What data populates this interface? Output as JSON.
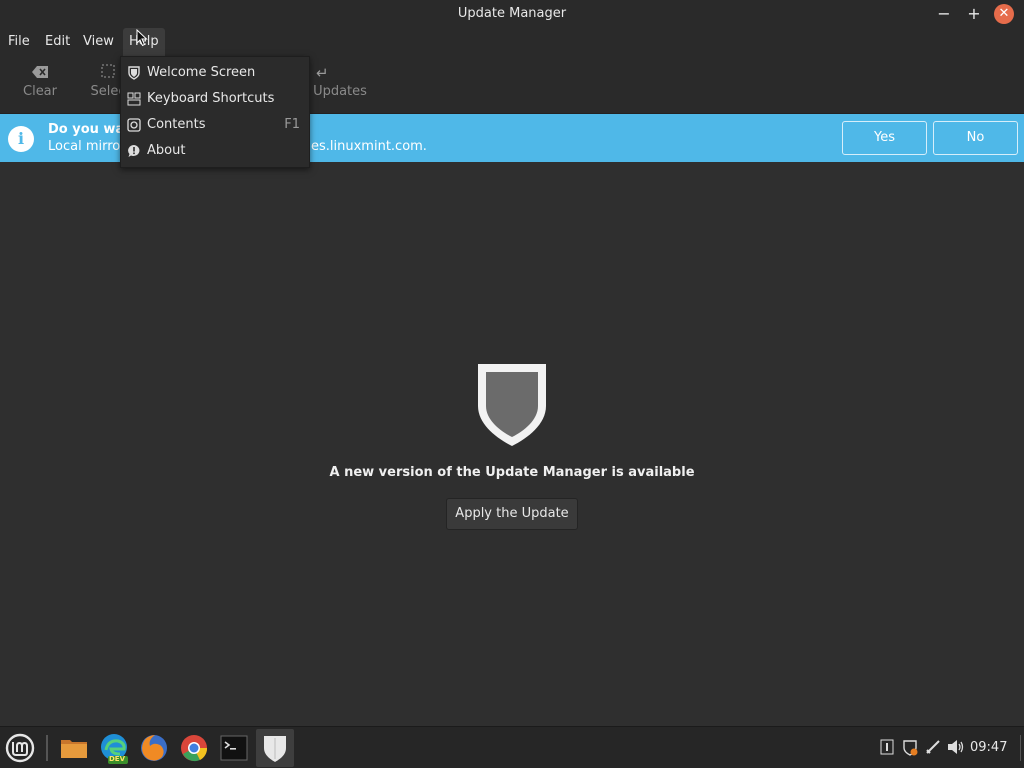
{
  "window": {
    "title": "Update Manager"
  },
  "menubar": {
    "items": [
      {
        "label": "File"
      },
      {
        "label": "Edit"
      },
      {
        "label": "View"
      },
      {
        "label": "Help"
      }
    ]
  },
  "toolbar": {
    "clear_label": "Clear",
    "select_label": "Selec",
    "updates_label": "Updates",
    "clear_icon": "backspace-icon",
    "select_icon": "select-all-icon",
    "updates_icon": "return-arrow-icon"
  },
  "help_menu": {
    "items": [
      {
        "label": "Welcome Screen",
        "icon": "shield-icon",
        "accel": ""
      },
      {
        "label": "Keyboard Shortcuts",
        "icon": "keyboard-shortcuts-icon",
        "accel": ""
      },
      {
        "label": "Contents",
        "icon": "help-contents-icon",
        "accel": "F1"
      },
      {
        "label": "About",
        "icon": "about-icon",
        "accel": ""
      }
    ]
  },
  "infobar": {
    "question": "Do you wan",
    "detail": "Local mirror",
    "detail_tail": "es.linuxmint.com.",
    "yes_label": "Yes",
    "no_label": "No",
    "color": "#4fb8e8"
  },
  "main": {
    "message": "A new version of the Update Manager is available",
    "apply_label": "Apply the Update"
  },
  "taskbar": {
    "apps": [
      "mint-menu-icon",
      "files-icon",
      "edge-dev-icon",
      "firefox-icon",
      "chrome-icon",
      "terminal-icon",
      "update-manager-icon"
    ],
    "edge_badge": "DEV",
    "clock": "09:47"
  }
}
